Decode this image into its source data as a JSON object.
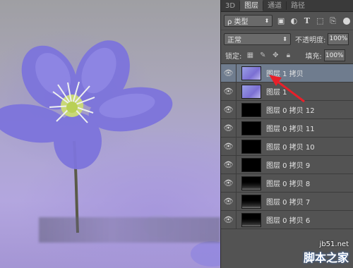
{
  "panel": {
    "tabs": [
      {
        "label": "3D"
      },
      {
        "label": "图层"
      },
      {
        "label": "通道"
      },
      {
        "label": "路径"
      }
    ],
    "filter": {
      "label": "ρ 类型"
    },
    "blend": {
      "label": "正常"
    },
    "opacity": {
      "label": "不透明度:",
      "value": "100%"
    },
    "lock": {
      "label": "锁定:"
    },
    "fill": {
      "label": "填充:",
      "value": "100%"
    },
    "layers": [
      {
        "name": "图层 1 拷贝",
        "selected": true
      },
      {
        "name": "图层 1"
      },
      {
        "name": "图层 0 拷贝 12"
      },
      {
        "name": "图层 0 拷贝 11"
      },
      {
        "name": "图层 0 拷贝 10"
      },
      {
        "name": "图层 0 拷贝 9"
      },
      {
        "name": "图层 0 拷贝 8"
      },
      {
        "name": "图层 0 拷贝 7"
      },
      {
        "name": "图层 0 拷贝 6"
      }
    ]
  },
  "watermark": {
    "url": "jb51.net",
    "text": "脚本之家"
  },
  "colors": {
    "accent_arrow": "#e8202a",
    "selection": "#6f7c8e"
  }
}
